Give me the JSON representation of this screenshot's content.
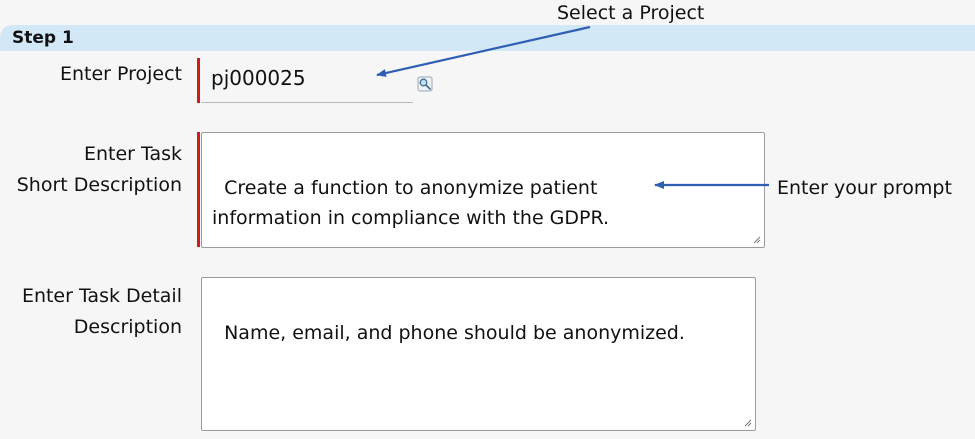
{
  "step": {
    "title": "Step 1"
  },
  "fields": {
    "project": {
      "label": "Enter Project",
      "value": "pj000025",
      "lookup_icon": "magnifier-lookup-icon"
    },
    "short_description": {
      "label_line1": "Enter Task",
      "label_line2": "Short Description",
      "value": "Create a function to anonymize patient\ninformation in compliance with the GDPR."
    },
    "detail_description": {
      "label_line1": "Enter Task Detail",
      "label_line2": "Description",
      "value": "Name, email, and phone should be anonymized."
    }
  },
  "annotations": {
    "select_project": "Select a Project",
    "enter_prompt": "Enter your prompt"
  },
  "colors": {
    "header_bg": "#d3e8f7",
    "required_bar": "#d11a1a",
    "arrow": "#2f5fb3"
  }
}
